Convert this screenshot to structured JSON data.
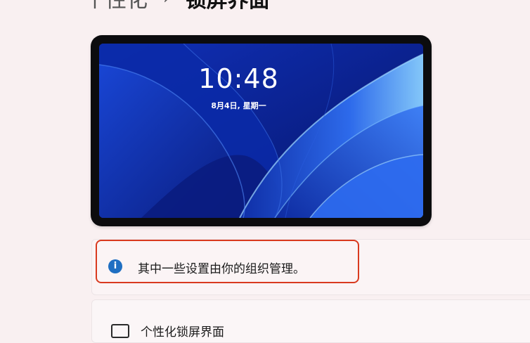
{
  "breadcrumb": {
    "parent": "个性化",
    "separator": "›",
    "current": "锁屏界面"
  },
  "preview": {
    "time": "10:48",
    "date": "8月4日, 星期一"
  },
  "notice": {
    "icon": "info-icon",
    "text": "其中一些设置由你的组织管理。"
  },
  "next_setting": {
    "icon": "lock-screen-icon",
    "label": "个性化锁屏界面"
  },
  "colors": {
    "background": "#f9f0f1",
    "highlight": "#d93a1f",
    "info": "#1f6fc2",
    "wallpaper": "#0a1c8a"
  }
}
